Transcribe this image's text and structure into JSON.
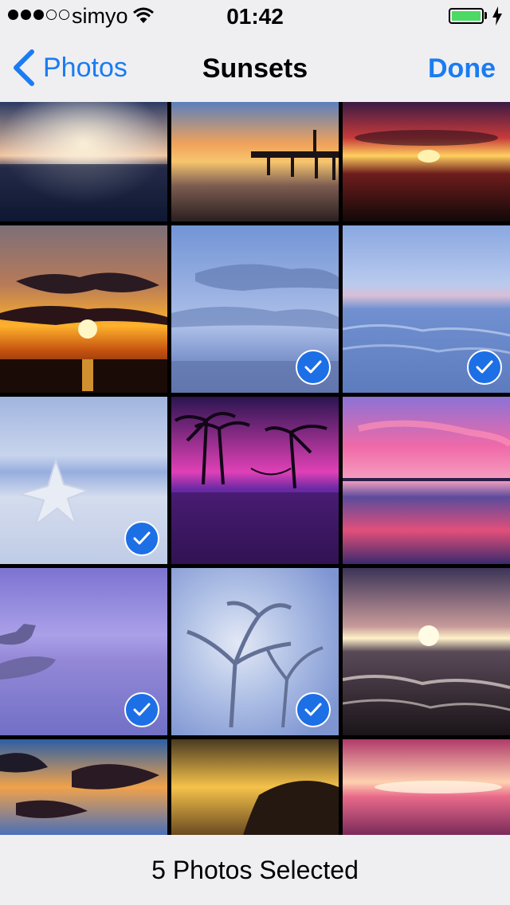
{
  "status_bar": {
    "carrier": "simyo",
    "time": "01:42",
    "signal_bars_filled": 3,
    "signal_bars_total": 5,
    "battery_color": "#4cd964"
  },
  "nav": {
    "back_label": "Photos",
    "title": "Sunsets",
    "done_label": "Done",
    "accent_color": "#1a7cf2"
  },
  "album": {
    "name": "Sunsets",
    "photos": [
      {
        "scene": "sunset-horizon",
        "selected": false
      },
      {
        "scene": "pier-sunset",
        "selected": false
      },
      {
        "scene": "red-sky-sunset",
        "selected": false
      },
      {
        "scene": "sun-rays-clouds",
        "selected": false
      },
      {
        "scene": "blue-sky-clouds",
        "selected": true
      },
      {
        "scene": "ocean-waves",
        "selected": true
      },
      {
        "scene": "starfish-beach",
        "selected": true
      },
      {
        "scene": "palm-trees-purple",
        "selected": false
      },
      {
        "scene": "pink-beach-reflection",
        "selected": false
      },
      {
        "scene": "purple-fog-tree",
        "selected": true
      },
      {
        "scene": "misty-tree",
        "selected": true
      },
      {
        "scene": "waves-sunset",
        "selected": false
      },
      {
        "scene": "orange-clouds",
        "selected": false
      },
      {
        "scene": "golden-sun-clouds",
        "selected": false
      },
      {
        "scene": "pink-sunset",
        "selected": false
      }
    ]
  },
  "toolbar": {
    "selection_label": "5 Photos Selected"
  }
}
